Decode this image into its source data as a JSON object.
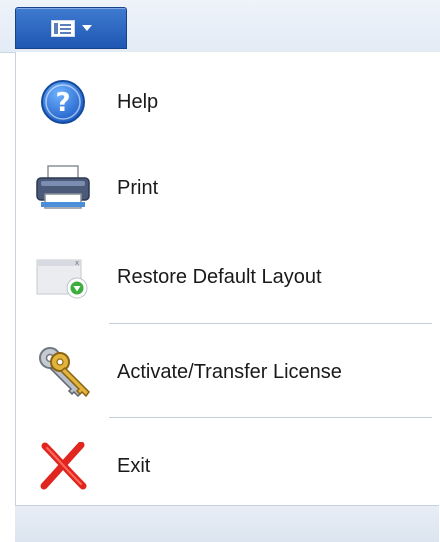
{
  "app_menu": {
    "button_icon": "document-menu-icon",
    "dropdown_icon": "chevron-down-icon"
  },
  "menu": {
    "items": [
      {
        "label": "Help",
        "icon": "help-icon"
      },
      {
        "label": "Print",
        "icon": "printer-icon"
      },
      {
        "label": "Restore Default Layout",
        "icon": "restore-layout-icon"
      },
      {
        "label": "Activate/Transfer License",
        "icon": "keys-icon"
      },
      {
        "label": "Exit",
        "icon": "close-x-icon"
      }
    ]
  },
  "colors": {
    "accent": "#2a62c1",
    "exit_red": "#e0261f"
  }
}
